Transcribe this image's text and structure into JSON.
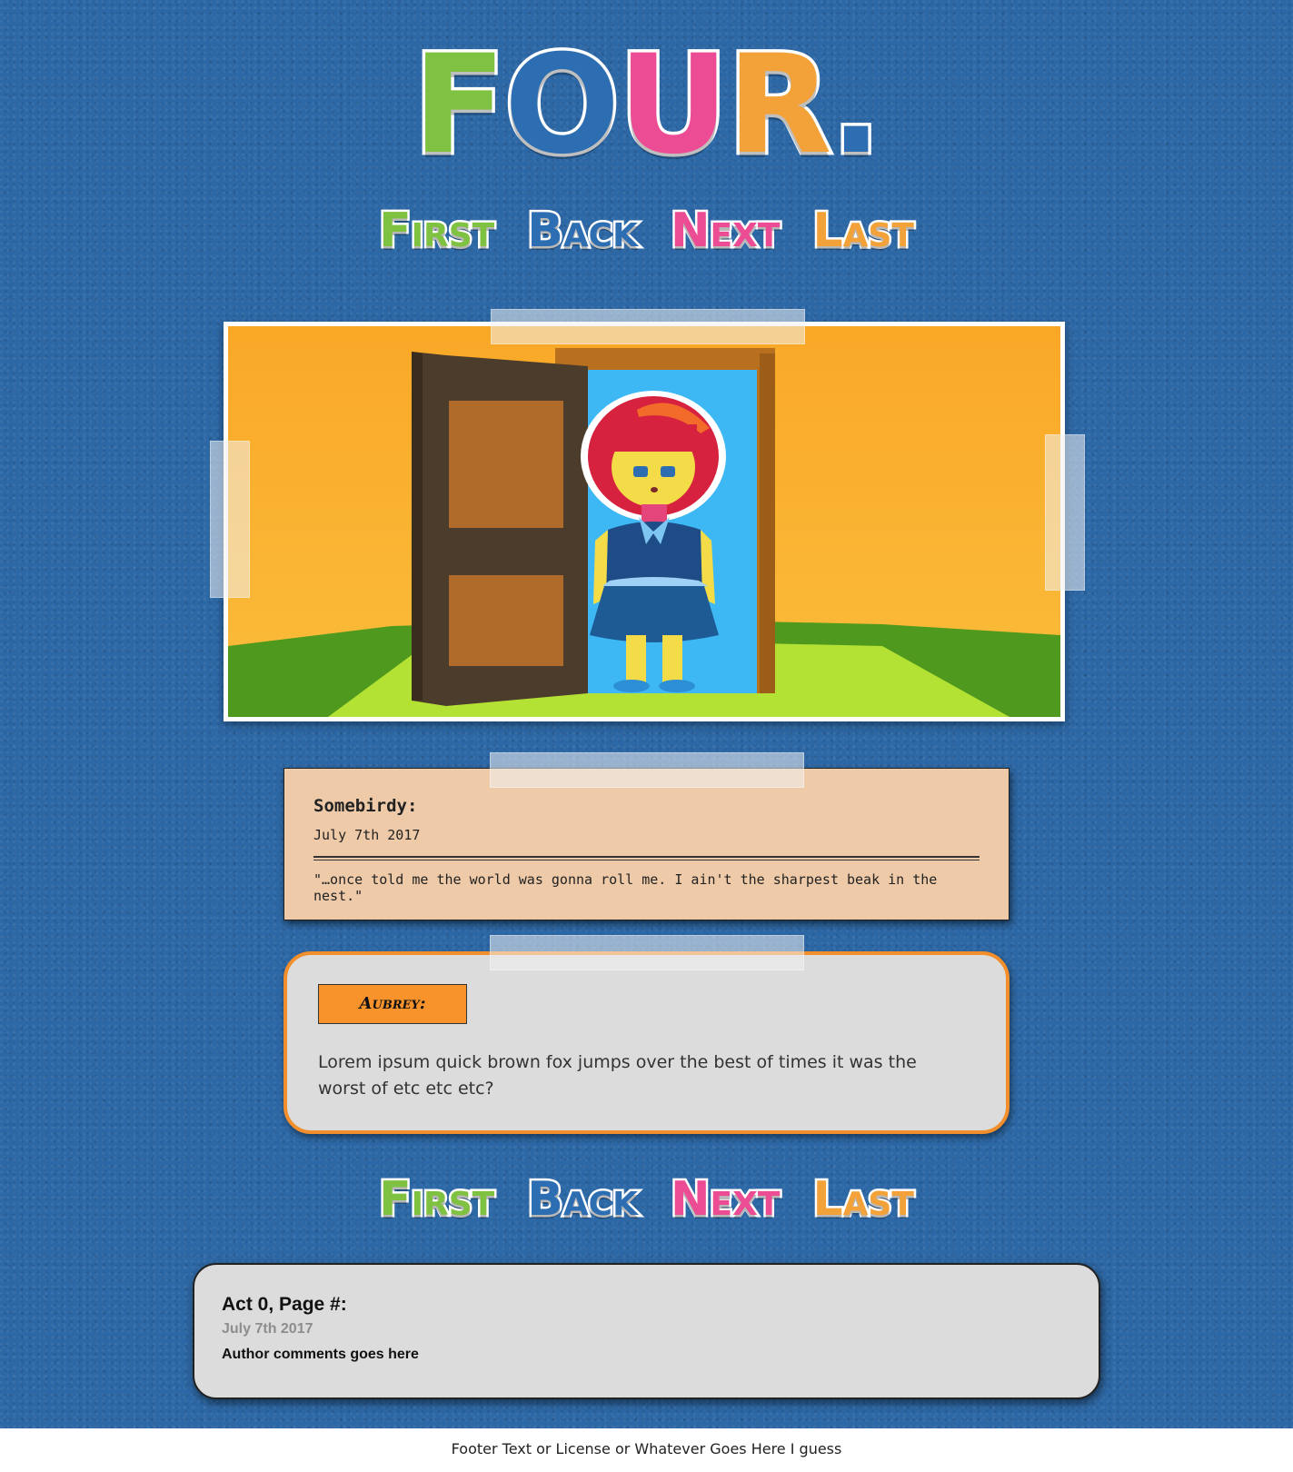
{
  "logo": {
    "letters": [
      {
        "char": "F",
        "color": "#7fc242"
      },
      {
        "char": "O",
        "color": "#2d6eb3"
      },
      {
        "char": "U",
        "color": "#ec4c94"
      },
      {
        "char": "R",
        "color": "#f3a23a"
      },
      {
        "char": ".",
        "color": "#2d6eb3"
      }
    ]
  },
  "nav": {
    "first": {
      "label": "First",
      "color": "#7fc242"
    },
    "back": {
      "label": "Back",
      "color": "#2d6eb3"
    },
    "next": {
      "label": "Next",
      "color": "#ec4c94"
    },
    "last": {
      "label": "Last",
      "color": "#f3a23a"
    }
  },
  "quote": {
    "name": "Somebirdy:",
    "date": "July 7th 2017",
    "text": "\"…once told me the world was gonna roll me. I ain't the sharpest beak in the nest.\""
  },
  "speaker": {
    "name": "Aubrey:",
    "text": "Lorem ipsum quick brown fox jumps over the best of times it was the worst of etc etc etc?"
  },
  "author": {
    "title": "Act 0, Page #:",
    "date": "July 7th 2017",
    "comment": "Author comments goes here"
  },
  "footer": {
    "text": "Footer Text or License or Whatever Goes Here I guess"
  },
  "colors": {
    "background": "#2d68a6",
    "quote_card": "#eecaa8",
    "speaker_border": "#f28f2c",
    "speaker_label": "#f8932c",
    "panel_sky": "#f9aa2a",
    "panel_grass": "#b4e234"
  }
}
